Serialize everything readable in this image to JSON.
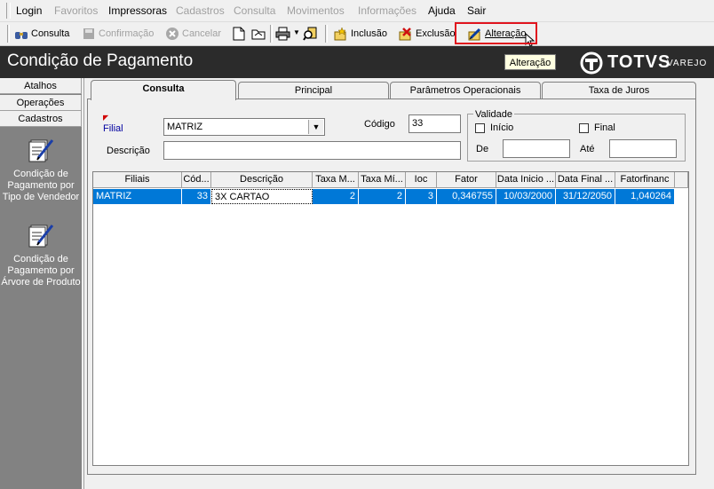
{
  "menu": {
    "items": [
      {
        "label": "Login",
        "disabled": false
      },
      {
        "label": "Favoritos",
        "disabled": true
      },
      {
        "label": "Impressoras",
        "disabled": false
      },
      {
        "label": "Cadastros",
        "disabled": true
      },
      {
        "label": "Consulta",
        "disabled": true
      },
      {
        "label": "Movimentos",
        "disabled": true
      },
      {
        "label": "Informações",
        "disabled": true
      },
      {
        "label": "Ajuda",
        "disabled": false
      },
      {
        "label": "Sair",
        "disabled": false
      }
    ]
  },
  "toolbar": {
    "consulta": "Consulta",
    "confirmacao": "Confirmação",
    "cancelar": "Cancelar",
    "inclusao": "Inclusão",
    "exclusao": "Exclusão",
    "alteracao": "Alteração"
  },
  "window": {
    "title": "Condição de Pagamento",
    "brand": "TOTVS",
    "brand_sub": "VAREJO",
    "tooltip": "Alteração"
  },
  "sidebar": {
    "tabs": [
      "Atalhos",
      "Operações",
      "Cadastros"
    ],
    "items": [
      {
        "label": "Condição de Pagamento por Tipo de Vendedor"
      },
      {
        "label": "Condição de Pagamento por Árvore de Produto"
      }
    ]
  },
  "tabs": [
    "Consulta",
    "Principal",
    "Parâmetros Operacionais",
    "Taxa de Juros"
  ],
  "form": {
    "filial_label": "Filial",
    "filial_value": "MATRIZ",
    "codigo_label": "Código",
    "codigo_value": "33",
    "descricao_label": "Descrição",
    "descricao_value": "",
    "validade_label": "Validade",
    "inicio_label": "Início",
    "final_label": "Final",
    "de_label": "De",
    "ate_label": "Até"
  },
  "grid": {
    "columns": [
      "Filiais",
      "Cód...",
      "Descrição",
      "Taxa M...",
      "Taxa Mí...",
      "Ioc",
      "Fator",
      "Data Inicio ...",
      "Data Final ...",
      "Fatorfinanc"
    ],
    "rows": [
      [
        "MATRIZ",
        "33",
        "3X CARTAO",
        "2",
        "2",
        "3",
        "0,346755",
        "10/03/2000",
        "31/12/2050",
        "1,040264"
      ]
    ]
  },
  "colors": {
    "title_bg": "#2b2b2b",
    "selection": "#0078d7",
    "highlight": "#e0141e"
  }
}
